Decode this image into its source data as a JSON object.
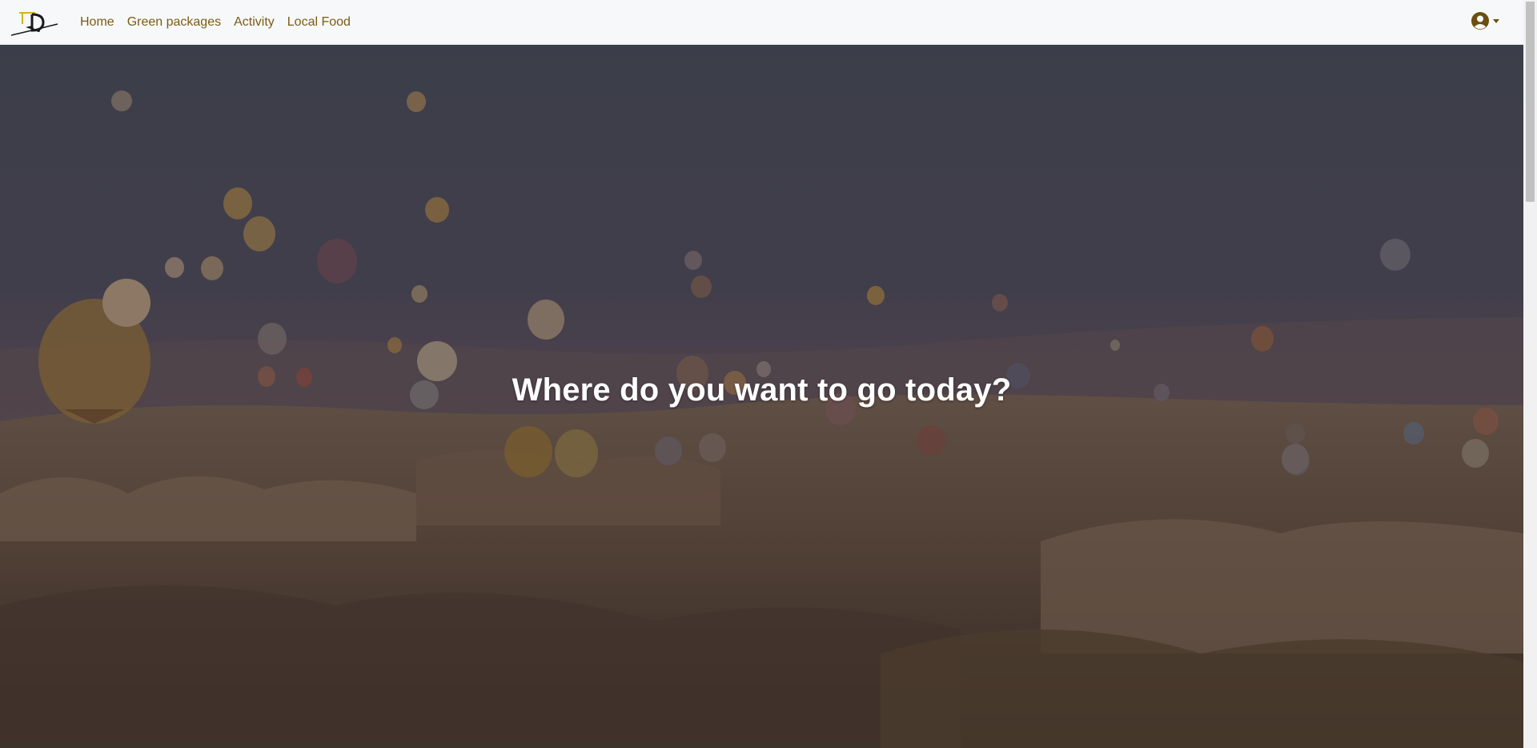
{
  "nav": {
    "links": [
      "Home",
      "Green packages",
      "Activity",
      "Local Food"
    ],
    "account_icon": "user-circle-icon",
    "dropdown_icon": "caret-down-icon"
  },
  "hero": {
    "title": "Where do you want to go today?"
  },
  "colors": {
    "nav_bg": "#f7f8fa",
    "link": "#7a5c12",
    "title": "#ffffff"
  }
}
